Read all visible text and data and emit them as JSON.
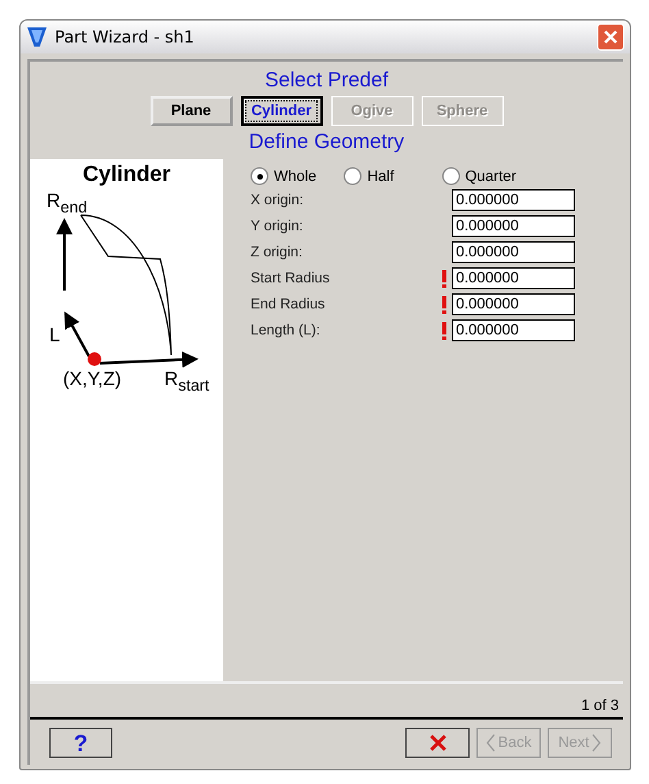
{
  "window": {
    "title": "Part Wizard - sh1"
  },
  "select_heading": "Select Predef",
  "predefs": [
    {
      "label": "Plane",
      "selected": false,
      "disabled": false
    },
    {
      "label": "Cylinder",
      "selected": true,
      "disabled": false
    },
    {
      "label": "Ogive",
      "selected": false,
      "disabled": true
    },
    {
      "label": "Sphere",
      "selected": false,
      "disabled": true
    }
  ],
  "define_heading": "Define Geometry",
  "diagram": {
    "title": "Cylinder",
    "r_end": "R$_{end}$",
    "l": "L",
    "origin": "(X,Y,Z)",
    "r_start": "R$_{start}$"
  },
  "portions": [
    {
      "label": "Whole",
      "selected": true
    },
    {
      "label": "Half",
      "selected": false
    },
    {
      "label": "Quarter",
      "selected": false
    }
  ],
  "fields": [
    {
      "label": "X origin:",
      "value": "0.000000",
      "required": false
    },
    {
      "label": "Y origin:",
      "value": "0.000000",
      "required": false
    },
    {
      "label": "Z origin:",
      "value": "0.000000",
      "required": false
    },
    {
      "label": "Start Radius",
      "value": "0.000000",
      "required": true
    },
    {
      "label": "End Radius",
      "value": "0.000000",
      "required": true
    },
    {
      "label": "Length (L):",
      "value": "0.000000",
      "required": true
    }
  ],
  "page_indicator": "1 of 3",
  "help_button": "?",
  "back_button": {
    "label": "Back",
    "disabled": true
  },
  "next_button": {
    "label": "Next",
    "disabled": true
  }
}
